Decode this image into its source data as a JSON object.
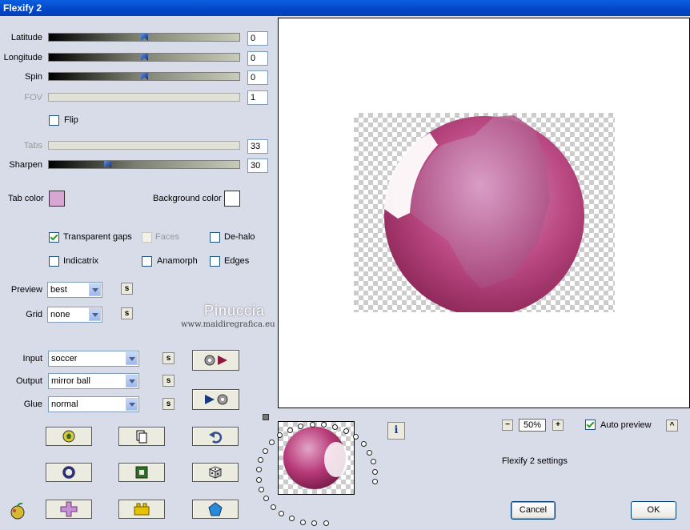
{
  "window": {
    "title": "Flexify 2"
  },
  "sliders": {
    "latitude": {
      "label": "Latitude",
      "value": "0",
      "fraction": 0.5
    },
    "longitude": {
      "label": "Longitude",
      "value": "0",
      "fraction": 0.5
    },
    "spin": {
      "label": "Spin",
      "value": "0",
      "fraction": 0.5
    },
    "fov": {
      "label": "FOV",
      "value": "1"
    },
    "tabs": {
      "label": "Tabs",
      "value": "33"
    },
    "sharpen": {
      "label": "Sharpen",
      "value": "30",
      "fraction": 0.3
    }
  },
  "flip": {
    "label": "Flip",
    "checked": false
  },
  "colors": {
    "tab_color_label": "Tab color",
    "tab_color": "#d8a6d3",
    "background_color_label": "Background color",
    "background_color": "#ffffff"
  },
  "options": {
    "transparent_gaps": {
      "label": "Transparent gaps",
      "checked": true
    },
    "faces": {
      "label": "Faces",
      "checked": false
    },
    "de_halo": {
      "label": "De-halo",
      "checked": false
    },
    "indicatrix": {
      "label": "Indicatrix",
      "checked": false
    },
    "anamorph": {
      "label": "Anamorph",
      "checked": false
    },
    "edges": {
      "label": "Edges",
      "checked": false
    }
  },
  "preview_select": {
    "label": "Preview",
    "value": "best"
  },
  "grid_select": {
    "label": "Grid",
    "value": "none"
  },
  "projection": {
    "input": {
      "label": "Input",
      "value": "soccer"
    },
    "output": {
      "label": "Output",
      "value": "mirror ball"
    },
    "glue": {
      "label": "Glue",
      "value": "normal"
    }
  },
  "s_button_label": "s",
  "watermark": {
    "name": "Pinuccia",
    "url": "www.maidiregrafica.eu"
  },
  "zoom": {
    "level": "50%",
    "minus": "−",
    "plus": "+"
  },
  "auto_preview": {
    "label": "Auto preview",
    "checked": true,
    "collapse": "^"
  },
  "settings_text": "Flexify 2 settings",
  "info_label": "i",
  "buttons": {
    "cancel": "Cancel",
    "ok": "OK"
  },
  "accent_colors": {
    "ball": "#b83a78",
    "titlebar": "#0a5fe0"
  }
}
